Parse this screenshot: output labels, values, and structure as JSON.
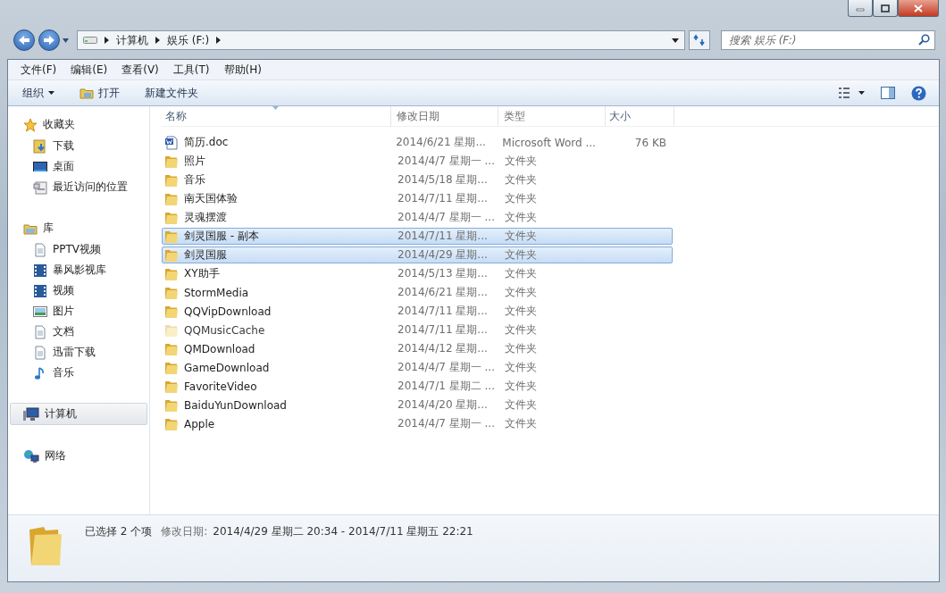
{
  "address": {
    "crumbs": [
      "计算机",
      "娱乐 (F:)"
    ]
  },
  "search": {
    "placeholder": "搜索 娱乐 (F:)"
  },
  "menu": [
    "文件(F)",
    "编辑(E)",
    "查看(V)",
    "工具(T)",
    "帮助(H)"
  ],
  "toolbar": [
    {
      "label": "组织",
      "kind": "dropdown"
    },
    {
      "label": "打开",
      "kind": "open"
    },
    {
      "label": "新建文件夹",
      "kind": "plain"
    }
  ],
  "sidebar": [
    {
      "label": "收藏夹",
      "kind": "star",
      "selected": false,
      "children": [
        {
          "label": "下载",
          "kind": "download"
        },
        {
          "label": "桌面",
          "kind": "desktop"
        },
        {
          "label": "最近访问的位置",
          "kind": "recent"
        }
      ]
    },
    {
      "label": "库",
      "kind": "library",
      "selected": false,
      "children": [
        {
          "label": "PPTV视频",
          "kind": "doc"
        },
        {
          "label": "暴风影视库",
          "kind": "film"
        },
        {
          "label": "视频",
          "kind": "film"
        },
        {
          "label": "图片",
          "kind": "image"
        },
        {
          "label": "文档",
          "kind": "doc"
        },
        {
          "label": "迅雷下载",
          "kind": "doc"
        },
        {
          "label": "音乐",
          "kind": "music"
        }
      ]
    },
    {
      "label": "计算机",
      "kind": "computer",
      "selected": true
    },
    {
      "label": "网络",
      "kind": "network",
      "selected": false
    }
  ],
  "columns": [
    "名称",
    "修改日期",
    "类型",
    "大小"
  ],
  "files": [
    {
      "name": "简历.doc",
      "date": "2014/6/21 星期...",
      "type": "Microsoft Word ...",
      "size": "76 KB",
      "kind": "doc",
      "selected": false,
      "hidden": false
    },
    {
      "name": "照片",
      "date": "2014/4/7 星期一 ...",
      "type": "文件夹",
      "kind": "folder",
      "selected": false,
      "hidden": false
    },
    {
      "name": "音乐",
      "date": "2014/5/18 星期...",
      "type": "文件夹",
      "kind": "folder",
      "selected": false,
      "hidden": false
    },
    {
      "name": "南天国体验",
      "date": "2014/7/11 星期...",
      "type": "文件夹",
      "kind": "folder",
      "selected": false,
      "hidden": false
    },
    {
      "name": "灵魂摆渡",
      "date": "2014/4/7 星期一 ...",
      "type": "文件夹",
      "kind": "folder",
      "selected": false,
      "hidden": false
    },
    {
      "name": "剑灵国服 - 副本",
      "date": "2014/7/11 星期...",
      "type": "文件夹",
      "kind": "folder",
      "selected": true,
      "hidden": false
    },
    {
      "name": "剑灵国服",
      "date": "2014/4/29 星期...",
      "type": "文件夹",
      "kind": "folder",
      "selected": true,
      "hidden": false
    },
    {
      "name": "XY助手",
      "date": "2014/5/13 星期...",
      "type": "文件夹",
      "kind": "folder",
      "selected": false,
      "hidden": false
    },
    {
      "name": "StormMedia",
      "date": "2014/6/21 星期...",
      "type": "文件夹",
      "kind": "folder",
      "selected": false,
      "hidden": false
    },
    {
      "name": "QQVipDownload",
      "date": "2014/7/11 星期...",
      "type": "文件夹",
      "kind": "folder",
      "selected": false,
      "hidden": false
    },
    {
      "name": "QQMusicCache",
      "date": "2014/7/11 星期...",
      "type": "文件夹",
      "kind": "folder",
      "selected": false,
      "hidden": true
    },
    {
      "name": "QMDownload",
      "date": "2014/4/12 星期...",
      "type": "文件夹",
      "kind": "folder",
      "selected": false,
      "hidden": false
    },
    {
      "name": "GameDownload",
      "date": "2014/4/7 星期一 ...",
      "type": "文件夹",
      "kind": "folder",
      "selected": false,
      "hidden": false
    },
    {
      "name": "FavoriteVideo",
      "date": "2014/7/1 星期二 ...",
      "type": "文件夹",
      "kind": "folder",
      "selected": false,
      "hidden": false
    },
    {
      "name": "BaiduYunDownload",
      "date": "2014/4/20 星期...",
      "type": "文件夹",
      "kind": "folder",
      "selected": false,
      "hidden": false
    },
    {
      "name": "Apple",
      "date": "2014/4/7 星期一 ...",
      "type": "文件夹",
      "kind": "folder",
      "selected": false,
      "hidden": false
    }
  ],
  "details": {
    "summary": "已选择 2 个项",
    "label": "修改日期:",
    "value": "2014/4/29 星期二 20:34 - 2014/7/11 星期五 22:21"
  }
}
